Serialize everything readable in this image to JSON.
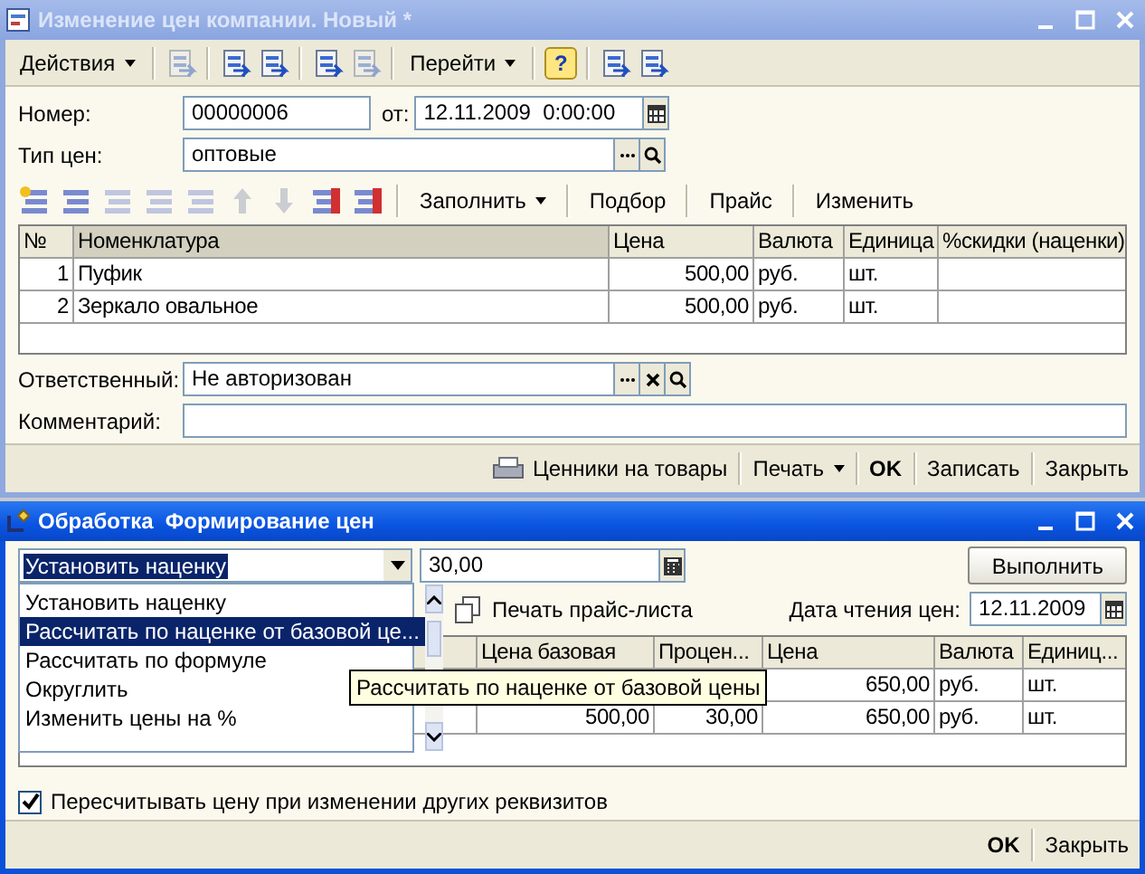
{
  "main_window": {
    "title": "Изменение цен компании. Новый *",
    "active": false,
    "toolbar": [
      {
        "kind": "menu",
        "label": "Действия"
      },
      {
        "kind": "separator"
      },
      {
        "kind": "icon",
        "disabled": true
      },
      {
        "kind": "separator"
      },
      {
        "kind": "icon",
        "disabled": false
      },
      {
        "kind": "icon",
        "disabled": false
      },
      {
        "kind": "separator"
      },
      {
        "kind": "icon",
        "disabled": false
      },
      {
        "kind": "icon",
        "disabled": true
      },
      {
        "kind": "separator"
      },
      {
        "kind": "menu",
        "label": "Перейти"
      },
      {
        "kind": "separator"
      },
      {
        "kind": "help",
        "label": "?"
      },
      {
        "kind": "separator"
      },
      {
        "kind": "icon",
        "disabled": false
      },
      {
        "kind": "icon",
        "disabled": false
      }
    ],
    "number_label": "Номер:",
    "number": "00000006",
    "date_label": "от:",
    "date": "12.11.2009  0:00:00",
    "price_type_label": "Тип цен:",
    "price_type": "оптовые",
    "table_toolbar": [
      {
        "label": "Заполнить",
        "dropdown": true
      },
      {
        "label": "Подбор",
        "dropdown": false
      },
      {
        "label": "Прайс",
        "dropdown": false
      },
      {
        "label": "Изменить",
        "dropdown": false
      }
    ],
    "table": {
      "columns": [
        {
          "label": "№",
          "highlighted": false
        },
        {
          "label": "Номенклатура",
          "highlighted": true
        },
        {
          "label": "Цена",
          "highlighted": false
        },
        {
          "label": "Валюта",
          "highlighted": false
        },
        {
          "label": "Единица",
          "highlighted": false
        },
        {
          "label": "%скидки (наценки)",
          "highlighted": false
        }
      ],
      "rows": [
        {
          "n": "1",
          "name": "Пуфик",
          "price": "500,00",
          "currency": "руб.",
          "unit": "шт."
        },
        {
          "n": "2",
          "name": "Зеркало овальное",
          "price": "500,00",
          "currency": "руб.",
          "unit": "шт."
        }
      ]
    },
    "responsible_label": "Ответственный:",
    "responsible": "Не авторизован",
    "comment_label": "Комментарий:",
    "footer_buttons": [
      {
        "kind": "print",
        "label": "Ценники на товары"
      },
      {
        "kind": "menu",
        "label": "Печать"
      },
      {
        "kind": "default",
        "label": "OK"
      },
      {
        "kind": "plain",
        "label": "Записать"
      },
      {
        "kind": "plain",
        "label": "Закрыть"
      }
    ]
  },
  "processing_window": {
    "title": "Обработка  Формирование цен",
    "active": true,
    "mode": "Установить наценку",
    "value": "30,00",
    "run_button": "Выполнить",
    "dropdown_options": [
      {
        "label": "Установить наценку",
        "selected": false
      },
      {
        "label": "Рассчитать по наценке от базовой це...",
        "selected": true
      },
      {
        "label": "Рассчитать по формуле",
        "selected": false
      },
      {
        "label": "Округлить",
        "selected": false
      },
      {
        "label": "Изменить цены на %",
        "selected": false
      }
    ],
    "tooltip": "Рассчитать по наценке от базовой цены",
    "print_price_list": "Печать прайс-листа",
    "date_label": "Дата чтения цен:",
    "date": "12.11.2009",
    "table": {
      "columns": [
        "Цена базовая",
        "Процен...",
        "Цена",
        "Валюта",
        "Единиц..."
      ],
      "rows": [
        {
          "price": "650,00",
          "currency": "руб.",
          "unit": "шт."
        },
        {
          "base": "500,00",
          "percent": "30,00",
          "price": "650,00",
          "currency": "руб.",
          "unit": "шт."
        }
      ]
    },
    "recalc": {
      "label": "Пересчитывать цену при изменении других реквизитов",
      "checked": true
    },
    "footer_buttons": [
      {
        "kind": "default",
        "label": "OK"
      },
      {
        "kind": "plain",
        "label": "Закрыть"
      }
    ]
  }
}
